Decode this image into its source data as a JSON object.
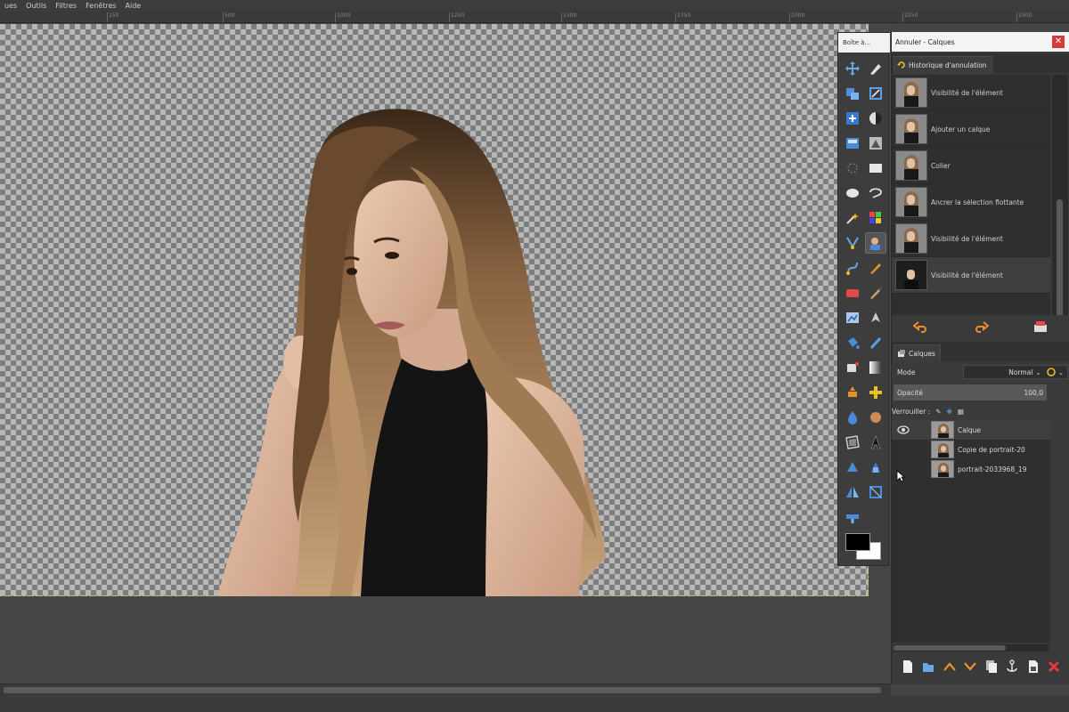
{
  "menu": [
    "ues",
    "Outils",
    "Filtres",
    "Fenêtres",
    "Aide"
  ],
  "ruler": [
    "250",
    "500",
    "1000",
    "1250",
    "1500",
    "1750",
    "2000",
    "2250",
    "2500"
  ],
  "toolbox": {
    "tab_label": "Boîte à..."
  },
  "dock": {
    "title": "Annuler - Calques",
    "history_tab": "Historique d'annulation",
    "history": [
      "Visibilité de l'élément",
      "Ajouter un calque",
      "Coller",
      "Ancrer la sélection flottante",
      "Visibilité de l'élément",
      "Visibilité de l'élément"
    ],
    "layers_tab": "Calques",
    "mode_label": "Mode",
    "mode_value": "Normal",
    "opacity_label": "Opacité",
    "opacity_value": "100,0",
    "lock_label": "Verrouiller :",
    "layers": [
      "Calque",
      "Copie de portrait-20",
      "portrait-2033968_19"
    ]
  },
  "colors": {
    "accent_orange": "#e8902a",
    "close_red": "#d33a3a",
    "selection_yellow": "#c9c060"
  }
}
